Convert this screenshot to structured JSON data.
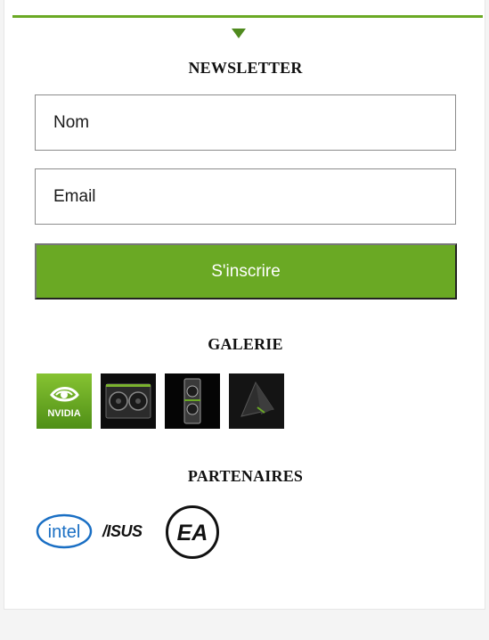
{
  "newsletter": {
    "title": "NEWSLETTER",
    "name_placeholder": "Nom",
    "email_placeholder": "Email",
    "submit_label": "S'inscrire"
  },
  "gallery": {
    "title": "GALERIE",
    "items": [
      {
        "icon": "nvidia-logo-icon",
        "text": "NVIDIA"
      },
      {
        "icon": "graphics-card-icon"
      },
      {
        "icon": "graphics-card-vertical-icon"
      },
      {
        "icon": "shield-tv-icon"
      }
    ]
  },
  "partners": {
    "title": "PARTENAIRES",
    "items": [
      {
        "icon": "intel-logo-icon",
        "text": "intel"
      },
      {
        "icon": "asus-logo-icon",
        "text": "/ISUS"
      },
      {
        "icon": "ea-logo-icon",
        "text": "EA"
      }
    ]
  },
  "colors": {
    "accent": "#6aa924",
    "arrow": "#4f8a1e",
    "background": "#f4f4f4"
  }
}
